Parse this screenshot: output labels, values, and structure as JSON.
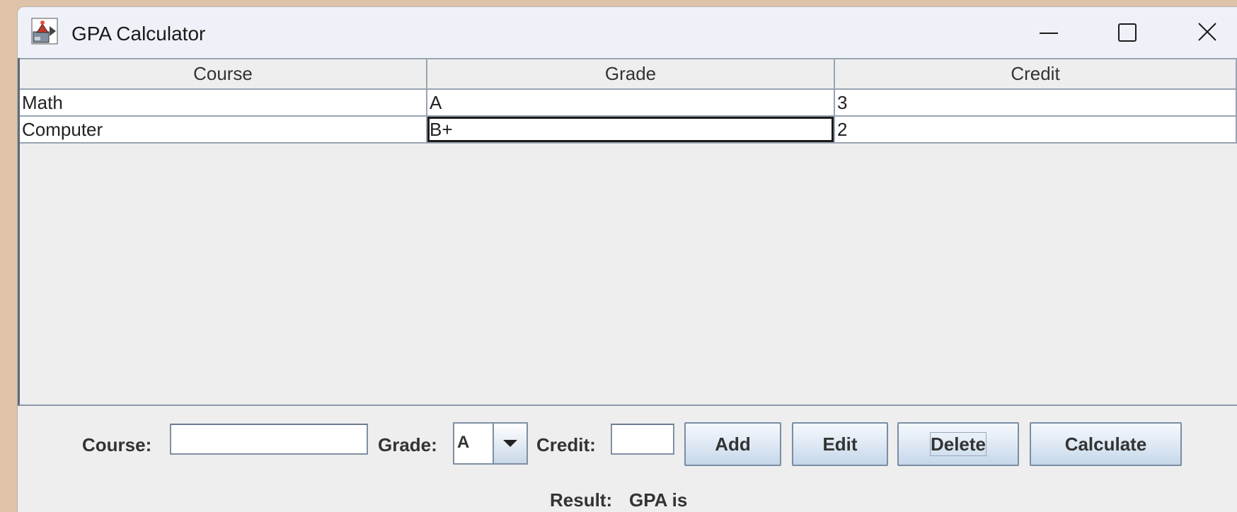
{
  "window": {
    "title": "GPA Calculator",
    "icon": "java-app-icon",
    "controls": [
      "minimize-icon",
      "maximize-icon",
      "close-icon"
    ]
  },
  "table": {
    "columns": [
      "Course",
      "Grade",
      "Credit"
    ],
    "rows": [
      [
        "Math",
        "A",
        "3"
      ],
      [
        "Computer",
        "B+",
        "2"
      ]
    ],
    "focused_cell": {
      "row": 1,
      "col": 1
    }
  },
  "form": {
    "course_label": "Course:",
    "course_value": "",
    "grade_label": "Grade:",
    "grade_selected": "A",
    "credit_label": "Credit:",
    "credit_value": "",
    "buttons": {
      "add": "Add",
      "edit": "Edit",
      "delete": "Delete",
      "calculate": "Calculate"
    },
    "result_label": "Result:",
    "result_text": "GPA is"
  }
}
